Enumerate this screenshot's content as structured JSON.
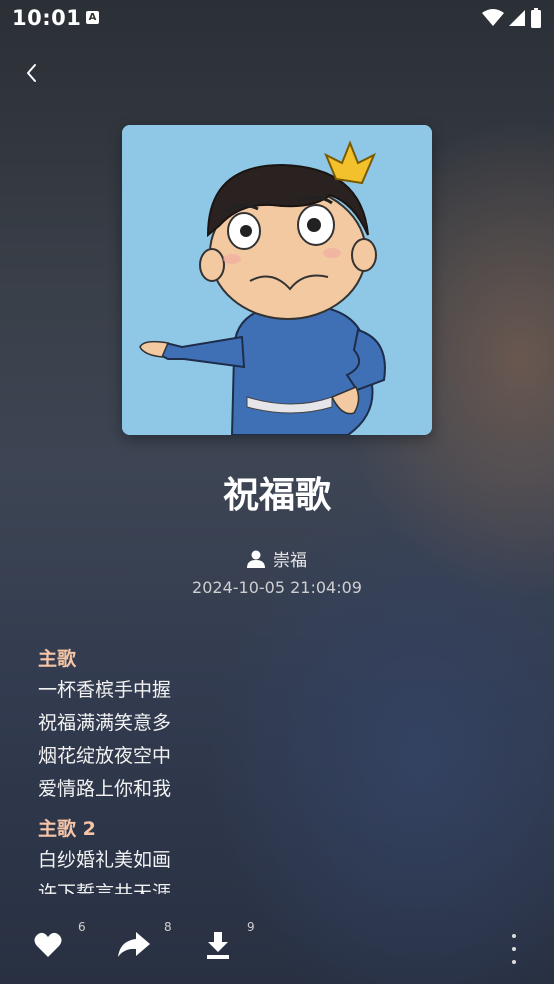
{
  "status_bar": {
    "time": "10:01",
    "notif_icon": "A"
  },
  "song": {
    "title": "祝福歌",
    "author": "崇福",
    "date": "2024-10-05 21:04:09"
  },
  "lyrics": [
    {
      "title": "主歌",
      "lines": [
        "一杯香槟手中握",
        "祝福满满笑意多",
        "烟花绽放夜空中",
        "爱情路上你和我"
      ]
    },
    {
      "title": "主歌 2",
      "lines": [
        "白纱婚礼美如画",
        "许下誓言共天涯"
      ]
    }
  ],
  "actions": {
    "like_count": "6",
    "share_count": "8",
    "download_count": "9"
  },
  "icons": {
    "back": "chevron-left-icon",
    "author": "person-icon",
    "like": "heart-icon",
    "share": "share-icon",
    "download": "download-icon",
    "more": "more-vertical-icon"
  }
}
